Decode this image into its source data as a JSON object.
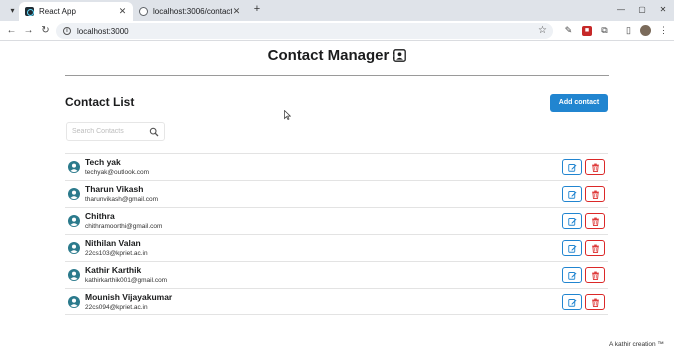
{
  "browser": {
    "tabs": [
      {
        "title": "React App",
        "active": true
      },
      {
        "title": "localhost:3006/contacts",
        "active": false
      }
    ],
    "url": "localhost:3000"
  },
  "header": {
    "title": "Contact Manager"
  },
  "contact_list": {
    "title": "Contact List",
    "add_button_label": "Add contact",
    "search_placeholder": "Search Contacts",
    "contacts": [
      {
        "name": "Tech yak",
        "email": "techyak@outlook.com"
      },
      {
        "name": "Tharun Vikash",
        "email": "tharunvikash@gmail.com"
      },
      {
        "name": "Chithra",
        "email": "chithramoorthi@gmail.com"
      },
      {
        "name": "Nithilan Valan",
        "email": "22cs103@kpriet.ac.in"
      },
      {
        "name": "Kathir Karthik",
        "email": "kathirkarthik001@gmail.com"
      },
      {
        "name": "Mounish Vijayakumar",
        "email": "22cs094@kpriet.ac.in"
      }
    ]
  },
  "footer": {
    "credit": "A kathir creation ™"
  },
  "colors": {
    "primary": "#2185d0",
    "danger": "#db2828",
    "avatar": "#2b7a8c",
    "text": "#1b1c1d"
  },
  "icons": {
    "header": "address-card-icon",
    "search": "search-icon",
    "avatar": "user-circle-icon",
    "edit": "edit-icon",
    "delete": "trash-icon"
  }
}
